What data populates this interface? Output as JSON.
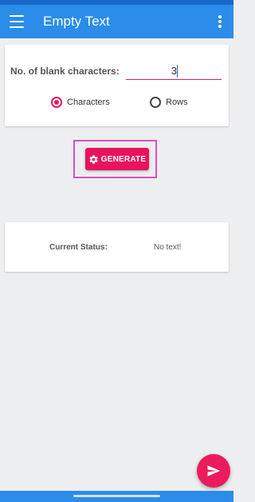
{
  "app_bar": {
    "title": "Empty Text",
    "menu_icon": "hamburger-menu-icon",
    "overflow_icon": "more-vert-icon",
    "color": "#2b8cea"
  },
  "input_card": {
    "blank_label": "No. of blank characters:",
    "blank_value": "3",
    "mode_options": [
      {
        "label": "Characters",
        "selected": true
      },
      {
        "label": "Rows",
        "selected": false
      }
    ]
  },
  "generate_button": {
    "label": "GENERATE",
    "icon": "gear-icon",
    "color": "#e8135d",
    "highlight_color": "#d94fc4"
  },
  "status_card": {
    "label": "Current Status:",
    "value": "No text!"
  },
  "fab": {
    "icon": "send-icon",
    "color": "#ea1c5e"
  }
}
